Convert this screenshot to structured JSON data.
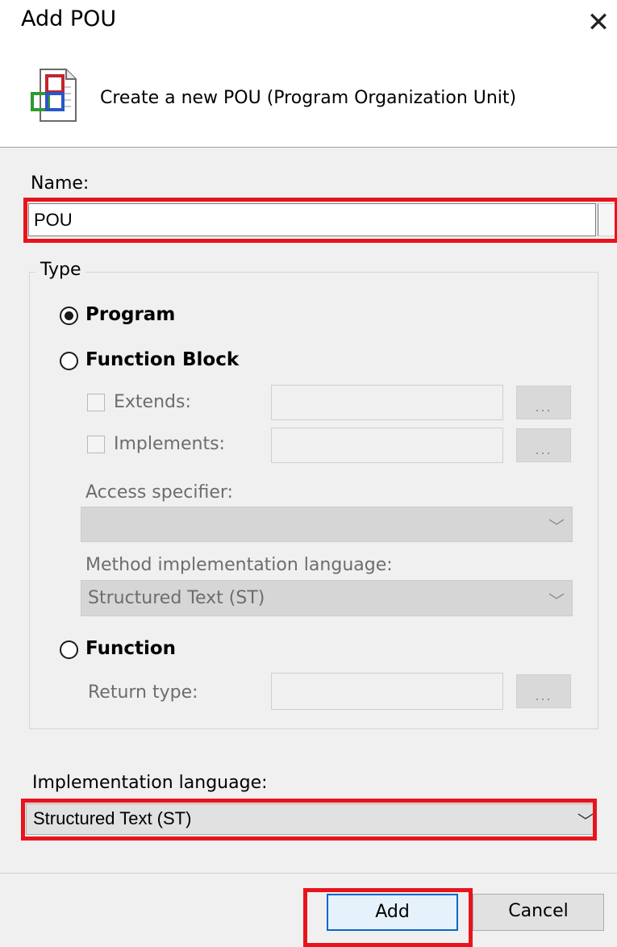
{
  "window": {
    "title": "Add POU",
    "close_icon": "close-icon"
  },
  "header": {
    "icon": "pou-document-icon",
    "description": "Create a new POU (Program Organization Unit)"
  },
  "name": {
    "label": "Name:",
    "value": "POU"
  },
  "type": {
    "legend": "Type",
    "options": {
      "program": {
        "label": "Program",
        "checked": true
      },
      "function_block": {
        "label": "Function Block",
        "checked": false
      },
      "function": {
        "label": "Function",
        "checked": false
      }
    },
    "function_block": {
      "extends_label": "Extends:",
      "implements_label": "Implements:",
      "browse_label": "...",
      "access_specifier_label": "Access specifier:",
      "access_specifier_value": "",
      "method_language_label": "Method implementation language:",
      "method_language_value": "Structured Text (ST)"
    },
    "function": {
      "return_type_label": "Return type:",
      "browse_label": "..."
    }
  },
  "implementation": {
    "label": "Implementation language:",
    "value": "Structured Text (ST)"
  },
  "buttons": {
    "add": "Add",
    "cancel": "Cancel"
  },
  "colors": {
    "highlight": "#e8141c",
    "default_button_border": "#0a66cc"
  }
}
